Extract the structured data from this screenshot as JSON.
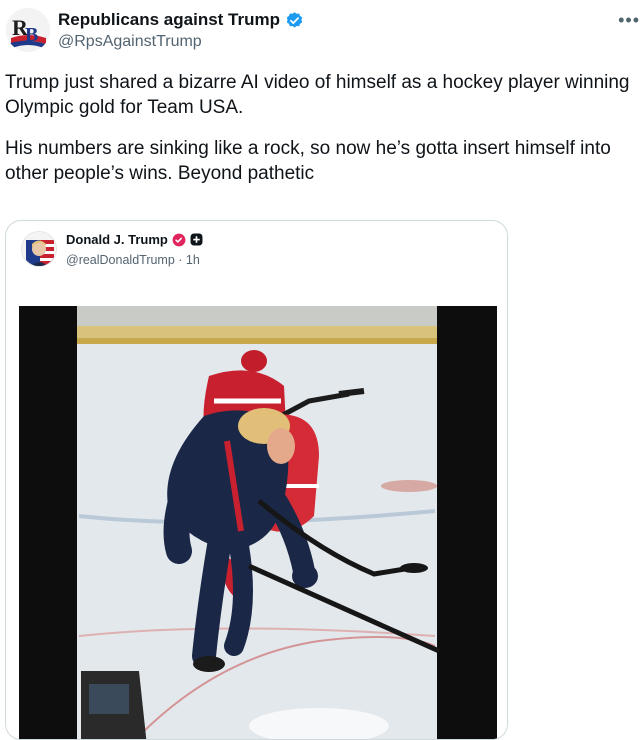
{
  "tweet": {
    "author": {
      "name": "Republicans against Trump",
      "handle": "@RpsAgainstTrump",
      "avatar_text": "RB",
      "verified": true
    },
    "more_icon": "more-dots-icon",
    "paragraphs": [
      "Trump just shared a bizarre AI video of himself as a hockey player winning Olympic gold for Team USA.",
      "His numbers are sinking like a rock, so now he’s gotta insert himself into other people’s wins. Beyond pathetic"
    ]
  },
  "quote": {
    "author": {
      "name": "Donald J. Trump",
      "handle": "@realDonaldTrump",
      "time": "1h"
    },
    "badges": [
      "verified-badge",
      "government-badge"
    ],
    "media": {
      "type": "video",
      "description_icon": "hockey-video"
    }
  },
  "colors": {
    "verified_blue": "#1d9bf0",
    "handle_gray": "#536471",
    "border": "#cfd9de",
    "text": "#0f1419",
    "quote_badge_red": "#e0245e"
  }
}
